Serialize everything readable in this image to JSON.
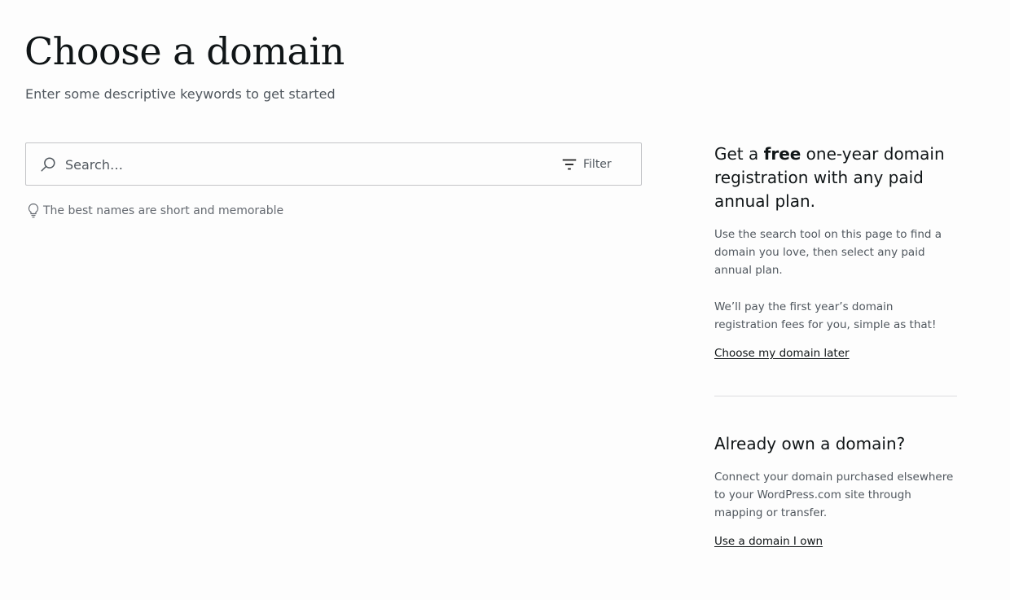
{
  "page": {
    "title": "Choose a domain",
    "subtitle": "Enter some descriptive keywords to get started"
  },
  "search": {
    "placeholder": "Search…",
    "filter_label": "Filter",
    "tip": "The best names are short and memorable"
  },
  "promo": {
    "heading_prefix": "Get a ",
    "heading_bold": "free",
    "heading_suffix": " one-year domain registration with any paid annual plan.",
    "paragraph1": "Use the search tool on this page to find a domain you love, then select any paid annual plan.",
    "paragraph2": "We’ll pay the first year’s domain registration fees for you, simple as that!",
    "link": "Choose my domain later"
  },
  "own_domain": {
    "heading": "Already own a domain?",
    "paragraph": "Connect your domain purchased elsewhere to your WordPress.com site through mapping or transfer.",
    "link": "Use a domain I own"
  },
  "icons": {
    "search": "search-icon",
    "filter": "filter-icon",
    "tip": "lightbulb-icon"
  },
  "colors": {
    "heading": "#101517",
    "text_muted": "#50575e",
    "border": "#c3c4c7",
    "divider": "#dcdcde"
  }
}
